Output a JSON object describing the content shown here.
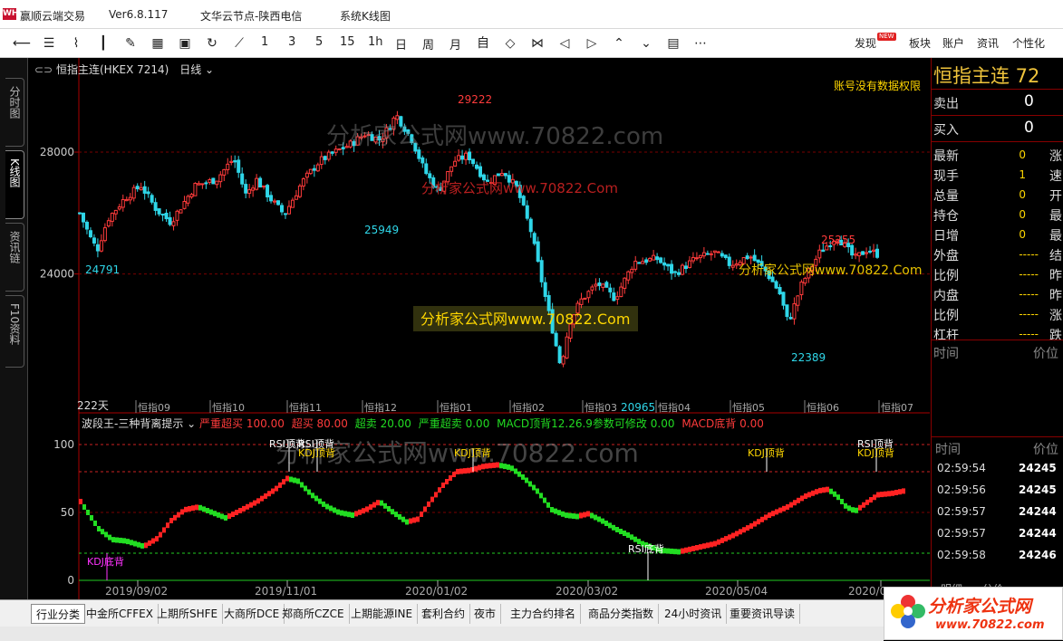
{
  "titlebar": {
    "logo": "WHO",
    "app": "赢顺云端交易",
    "version": "Ver6.8.117",
    "server": "文华云节点-陕西电信",
    "page": "系统K线图"
  },
  "toolbar": {
    "icons": [
      "back-icon",
      "list-icon",
      "line-chart-icon",
      "candle-icon",
      "draw-icon",
      "table-icon",
      "save-icon",
      "refresh-icon",
      "trend-icon"
    ],
    "periods": [
      "1",
      "3",
      "5",
      "15",
      "1h",
      "日",
      "周",
      "月"
    ],
    "nav_icons": [
      "self-icon",
      "expand-icon",
      "shrink-icon",
      "left-icon",
      "right-icon",
      "up-icon",
      "down-icon",
      "layout-icon",
      "more-icon"
    ],
    "right": [
      "发现",
      "板块",
      "账户",
      "资讯",
      "个性化"
    ],
    "new_badge": "NEW"
  },
  "leftbar": {
    "tabs": [
      "分时图",
      "K线图",
      "资讯链",
      "F10资料"
    ]
  },
  "chart": {
    "symbol": "恒指主连(HKEX 7214)",
    "period": "日线",
    "permission_note": "账号没有数据权限",
    "bar_count": "222天",
    "watermark_main": "分析家公式网www.70822.com",
    "watermark_red": "分析家公式网www.70822.Com",
    "watermark_right": "分析家公式网www.70822.Com",
    "watermark_box": "分析家公式网www.70822.Com",
    "watermark_ind": "分析家公式网www.70822.com",
    "y_ticks": [
      "28000",
      "24000"
    ],
    "month_labels": [
      "恒指09",
      "恒指10",
      "恒指11",
      "恒指12",
      "恒指01",
      "恒指02",
      "恒指03",
      "恒指04",
      "恒指05",
      "恒指06",
      "恒指07"
    ],
    "price_labels": {
      "high": "29222",
      "low": "20965",
      "p1": "24791",
      "p2": "25949",
      "p3": "25255",
      "p4": "22389"
    },
    "colors": {
      "up": "#ff3b3b",
      "down": "#2fd6e8",
      "grid": "#7a0000"
    }
  },
  "chart_data": [
    {
      "type": "candlestick",
      "title": "恒指主连(HKEX 7214) 日线",
      "ylim": [
        19500,
        30200
      ],
      "y_ticks": [
        24000,
        28000
      ],
      "annotations": [
        {
          "label": "24791",
          "value": 24791
        },
        {
          "label": "25949",
          "value": 25949
        },
        {
          "label": "29222",
          "value": 29222
        },
        {
          "label": "20965",
          "value": 20965
        },
        {
          "label": "25255",
          "value": 25255
        },
        {
          "label": "22389",
          "value": 22389
        }
      ],
      "x": [
        "2019-08",
        "2019-09",
        "2019-10",
        "2019-11",
        "2019-12",
        "2020-01",
        "2020-02",
        "2020-03",
        "2020-04",
        "2020-05",
        "2020-06",
        "2020-07"
      ],
      "close": [
        26000,
        26500,
        26300,
        27400,
        27000,
        28200,
        27600,
        23500,
        24100,
        24200,
        24700,
        24500
      ]
    },
    {
      "type": "line",
      "title": "波段王-三种背离提示",
      "ylim": [
        0,
        100
      ],
      "y_ticks": [
        0,
        50,
        100
      ],
      "x": [
        "2019/09/02",
        "2019/11/01",
        "2020/01/02",
        "2020/03/02",
        "2020/05/04",
        "2020/07"
      ],
      "reference_levels": {
        "严重超买": 100,
        "超买": 80,
        "超卖": 20,
        "严重超卖": 0
      },
      "signals": [
        "RSI顶背",
        "KDJ顶背",
        "KDJ底背",
        "RSI底背"
      ]
    }
  ],
  "indicator": {
    "name": "波段王-三种背离提示",
    "params": [
      {
        "label": "严重超买",
        "value": "100.00",
        "color": "#ff3b3b"
      },
      {
        "label": "超买",
        "value": "80.00",
        "color": "#ff3b3b"
      },
      {
        "label": "超卖",
        "value": "20.00",
        "color": "#22dd22"
      },
      {
        "label": "严重超卖",
        "value": "0.00",
        "color": "#22dd22"
      }
    ],
    "macd_top": "MACD顶背12.26.9参数可修改",
    "macd_top_val": "0.00",
    "macd_bottom": "MACD底背",
    "macd_bottom_val": "0.00",
    "y_ticks": [
      "100",
      "50",
      "0"
    ],
    "date_labels": [
      "2019/09/02",
      "2019/11/01",
      "2020/01/02",
      "2020/03/02",
      "2020/05/04",
      "2020/07"
    ],
    "signals": {
      "rsi_top_1": "RSI顶背",
      "rsi_top_2": "RSI顶背",
      "kdj_top_1": "KDJ顶背",
      "kdj_top_2": "KDJ顶背",
      "kdj_top_3": "KDJ顶背",
      "rsi_top_3": "RSI顶背",
      "kdj_top_4": "KDJ顶背",
      "kdj_bottom": "KDJ底背",
      "rsi_bottom": "RSI底背"
    }
  },
  "rightpanel": {
    "title": "恒指主连 72",
    "sell_label": "卖出",
    "sell_val": "0",
    "buy_label": "买入",
    "buy_val": "0",
    "quotes": [
      {
        "label": "最新",
        "value": "0",
        "right": "涨"
      },
      {
        "label": "现手",
        "value": "1",
        "right": "速"
      },
      {
        "label": "总量",
        "value": "0",
        "right": "开"
      },
      {
        "label": "持仓",
        "value": "0",
        "right": "最"
      },
      {
        "label": "日增",
        "value": "0",
        "right": "最"
      },
      {
        "label": "外盘",
        "value": "-----",
        "right": "结"
      },
      {
        "label": "比例",
        "value": "-----",
        "right": "昨"
      },
      {
        "label": "内盘",
        "value": "-----",
        "right": "昨"
      },
      {
        "label": "比例",
        "value": "-----",
        "right": "涨"
      },
      {
        "label": "杠杆",
        "value": "-----",
        "right": "跌"
      }
    ],
    "tick_head_time": "时间",
    "tick_head_price": "价位",
    "ticks": [
      {
        "time": "02:59:54",
        "price": "24245"
      },
      {
        "time": "02:59:56",
        "price": "24245"
      },
      {
        "time": "02:59:57",
        "price": "24244"
      },
      {
        "time": "02:59:57",
        "price": "24244"
      },
      {
        "time": "02:59:58",
        "price": "24246"
      }
    ],
    "tabs": [
      "明细",
      "分价"
    ]
  },
  "bottombar": {
    "tabs": [
      "行业分类",
      "中金所CFFEX",
      "上期所SHFE",
      "大商所DCE",
      "郑商所CZCE",
      "上期能源INE",
      "套利合约",
      "夜市",
      "主力合约排名",
      "商品分类指数",
      "24小时资讯",
      "重要资讯导读"
    ]
  },
  "badge": {
    "line1": "分析家公式网",
    "line2": "www.70822.com"
  }
}
